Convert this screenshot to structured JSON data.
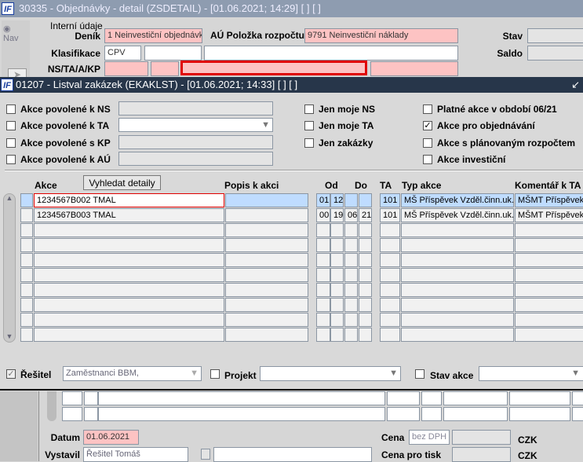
{
  "parent": {
    "title": "30335 - Objednávky - detail (ZSDETAIL) - [01.06.2021; 14:29]  [ ]  [ ]",
    "nav": "Nav",
    "section": "Interní údaje",
    "denik_label": "Deník",
    "denik": "1 Neinvestiční objednávk",
    "au_label": "AÚ Položka rozpočtu",
    "au": "9791 Neinvestiční náklady",
    "stav_label": "Stav",
    "saldo_label": "Saldo",
    "klas_label": "Klasifikace",
    "klas": "CPV",
    "ns_label": "NS/TA/A/KP",
    "datum_label": "Datum",
    "datum": "01.06.2021",
    "vystavil_label": "Vystavil",
    "vystavil": "Řešitel Tomáš",
    "cena_label": "Cena",
    "cena_placeholder": "bez DPH",
    "cena_tisk_label": "Cena pro tisk",
    "czk": "CZK"
  },
  "child": {
    "title": "01207 - Listval zakázek (EKAKLST) - [01.06.2021; 14:33]  [ ]  [ ]",
    "filters_left": [
      {
        "label": "Akce povolené k NS",
        "checked": false
      },
      {
        "label": "Akce povolené k TA",
        "checked": false
      },
      {
        "label": "Akce povolené s KP",
        "checked": false
      },
      {
        "label": "Akce povolené k AÚ",
        "checked": false
      }
    ],
    "filters_mid": [
      {
        "label": "Jen moje NS",
        "checked": false
      },
      {
        "label": "Jen moje TA",
        "checked": false
      },
      {
        "label": "Jen zakázky",
        "checked": false
      }
    ],
    "filters_right": [
      {
        "label": "Platné akce v období 06/21",
        "checked": false
      },
      {
        "label": "Akce pro objednávání",
        "checked": true
      },
      {
        "label": "Akce s plánovaným rozpočtem",
        "checked": false
      },
      {
        "label": "Akce investiční",
        "checked": false
      }
    ],
    "search_button": "Vyhledat detaily",
    "columns": {
      "akce": "Akce",
      "popis": "Popis k akci",
      "od": "Od",
      "do": "Do",
      "ta": "TA",
      "typ": "Typ akce",
      "komentar": "Komentář k TA"
    },
    "rows": [
      {
        "akce": "1234567B002 TMAL",
        "popis": "",
        "od1": "01",
        "od2": "12",
        "do1": "",
        "do2": "",
        "ta": "101",
        "typ": "MŠ Příspěvek Vzděl.činn.uk.A",
        "komentar": "MŠMT Příspěvek V"
      },
      {
        "akce": "1234567B003 TMAL",
        "popis": "",
        "od1": "00",
        "od2": "19",
        "do1": "06",
        "do2": "21",
        "ta": "101",
        "typ": "MŠ Příspěvek Vzděl.činn.uk.A",
        "komentar": "MŠMT Příspěvek V"
      }
    ],
    "resitel_label": "Řešitel",
    "resitel": "Zaměstnanci BBM,",
    "projekt_label": "Projekt",
    "stav_akce_label": "Stav akce"
  }
}
